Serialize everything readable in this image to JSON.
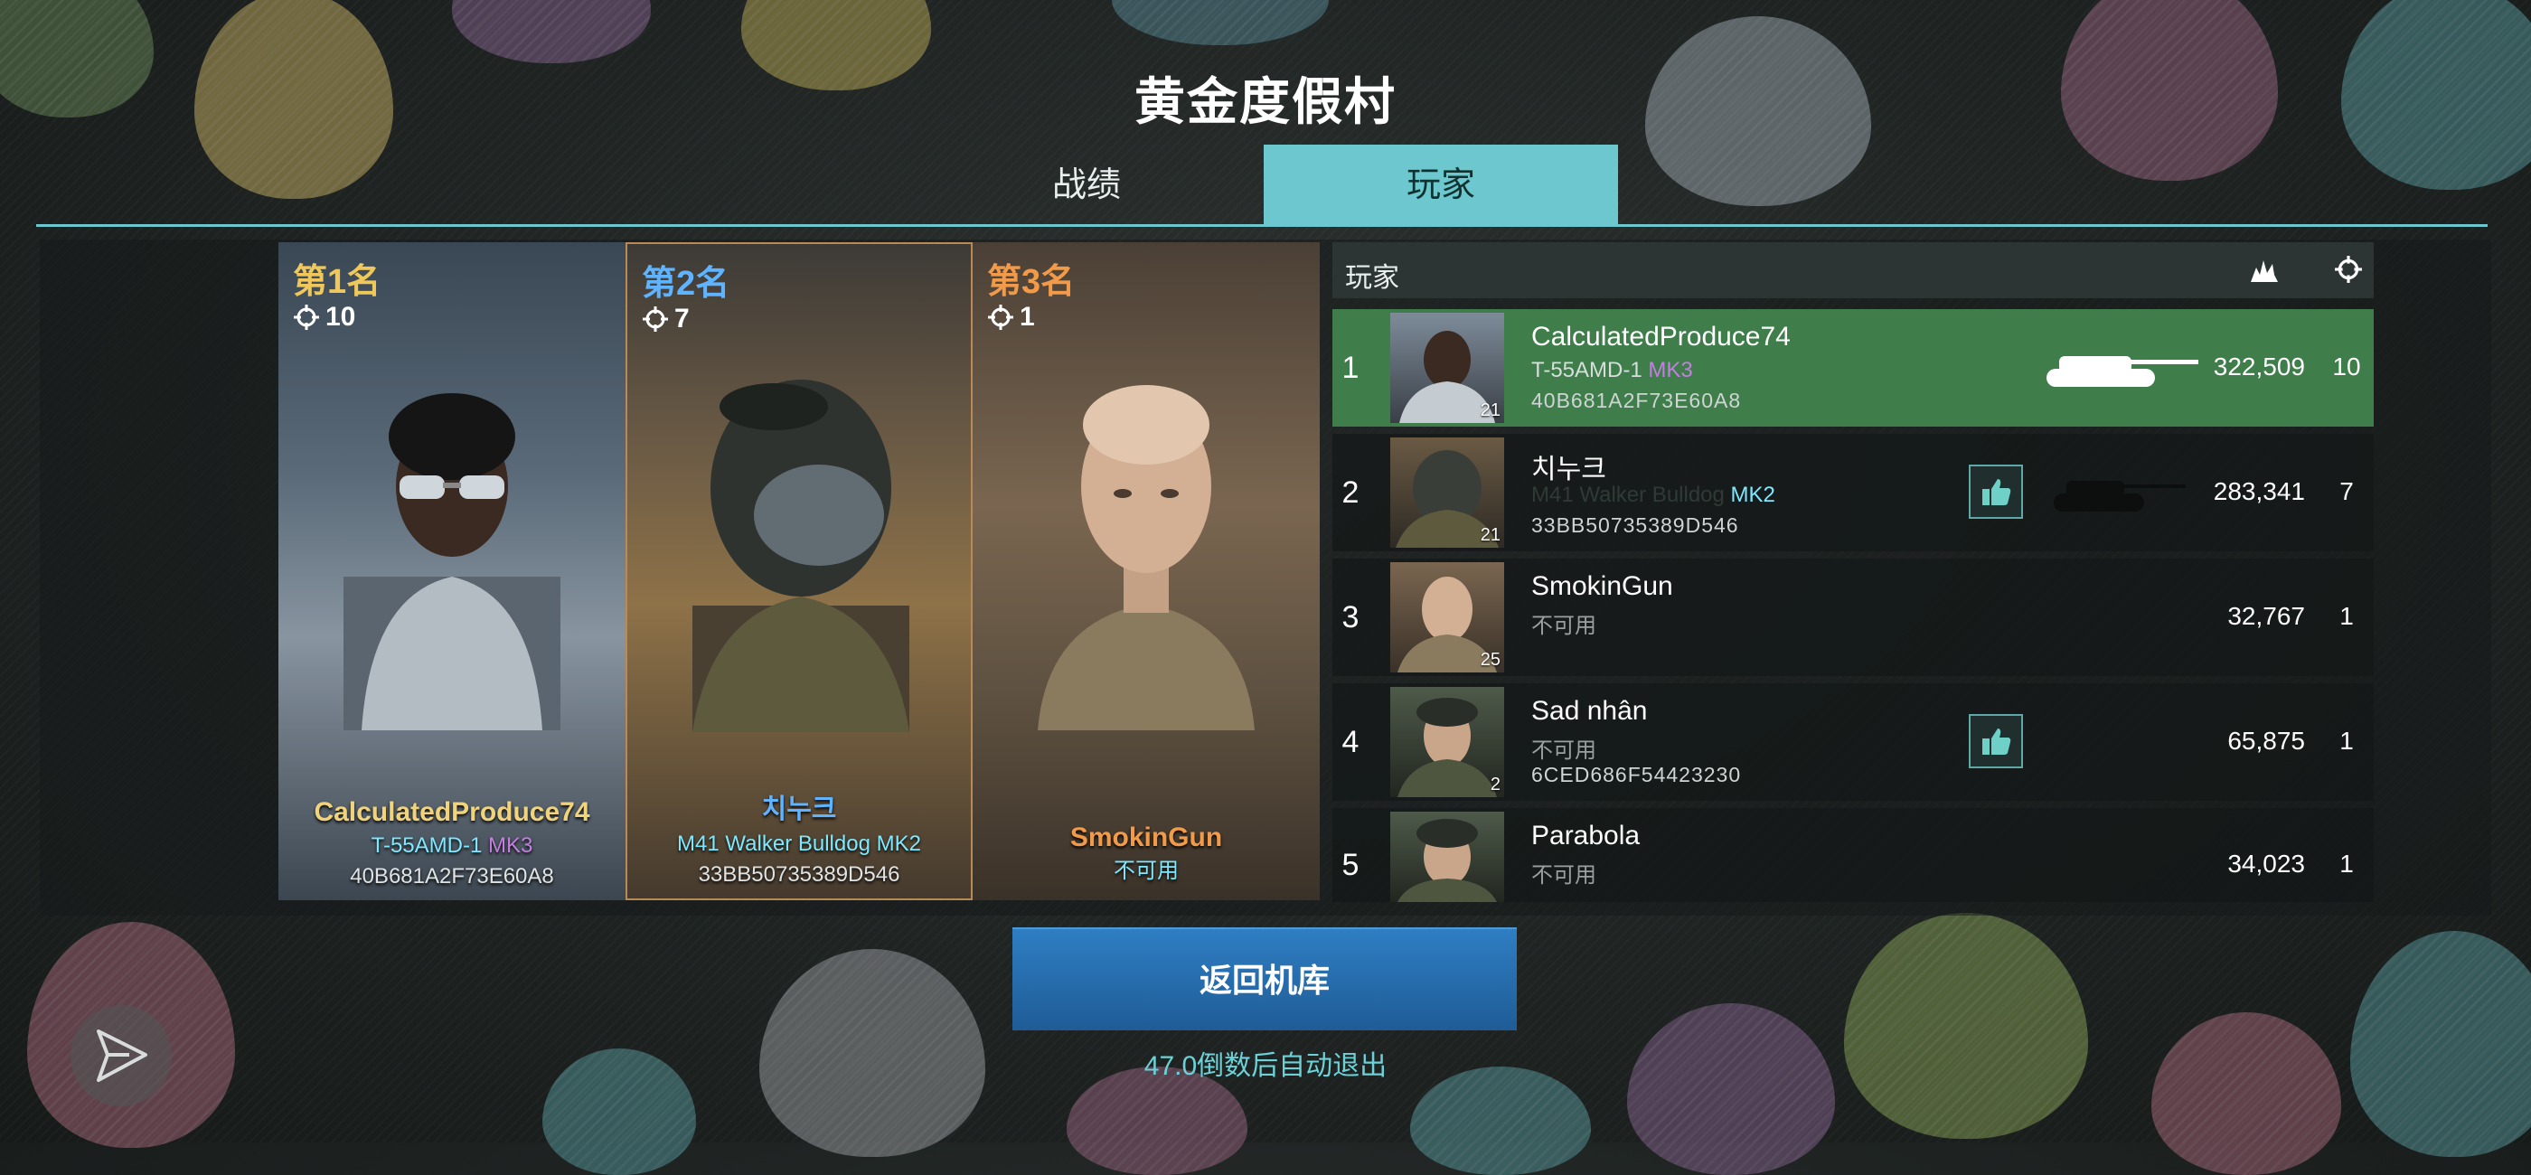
{
  "title": "黄金度假村",
  "tabs": [
    "战绩",
    "玩家"
  ],
  "podium": [
    {
      "rank": "第1名",
      "kills": "10",
      "name": "CalculatedProduce74",
      "vehicle": "T-55AMD-1",
      "mark": "MK3",
      "id": "40B681A2F73E60A8",
      "rank_color": "#f0c75a",
      "name_color": "#f0d37a"
    },
    {
      "rank": "第2名",
      "kills": "7",
      "name": "치누크",
      "vehicle": "M41 Walker Bulldog",
      "mark": "MK2",
      "id": "33BB50735389D546",
      "rank_color": "#5fb3ff",
      "name_color": "#5fb3ff"
    },
    {
      "rank": "第3名",
      "kills": "1",
      "name": "SmokinGun",
      "vehicle": "不可用",
      "mark": "",
      "id": "",
      "rank_color": "#f09a4a",
      "name_color": "#f09a4a"
    }
  ],
  "table": {
    "header": "玩家",
    "header_icons": [
      "explosion-icon",
      "crosshair-icon"
    ],
    "rows": [
      {
        "num": "1",
        "name": "CalculatedProduce74",
        "vehicle": "T-55AMD-1",
        "mark": "MK3",
        "id": "40B681A2F73E60A8",
        "score": "322,509",
        "kills": "10",
        "level": "21"
      },
      {
        "num": "2",
        "name": "치누크",
        "vehicle": "M41 Walker Bulldog",
        "mark": "MK2",
        "id": "33BB50735389D546",
        "score": "283,341",
        "kills": "7",
        "level": "21"
      },
      {
        "num": "3",
        "name": "SmokinGun",
        "vehicle": "不可用",
        "mark": "",
        "id": "",
        "score": "32,767",
        "kills": "1",
        "level": "25"
      },
      {
        "num": "4",
        "name": "Sad nhân",
        "vehicle": "不可用",
        "mark": "",
        "id": "6CED686F54423230",
        "score": "65,875",
        "kills": "1",
        "level": "2"
      },
      {
        "num": "5",
        "name": "Parabola",
        "vehicle": "不可用",
        "mark": "",
        "id": "",
        "score": "34,023",
        "kills": "1",
        "level": ""
      }
    ]
  },
  "return_button": "返回机库",
  "countdown": "47.0倒数后自动退出",
  "colors": {
    "accent": "#6cc7cf",
    "selected_row": "#3f7e4a",
    "button": "#2a72b5"
  }
}
